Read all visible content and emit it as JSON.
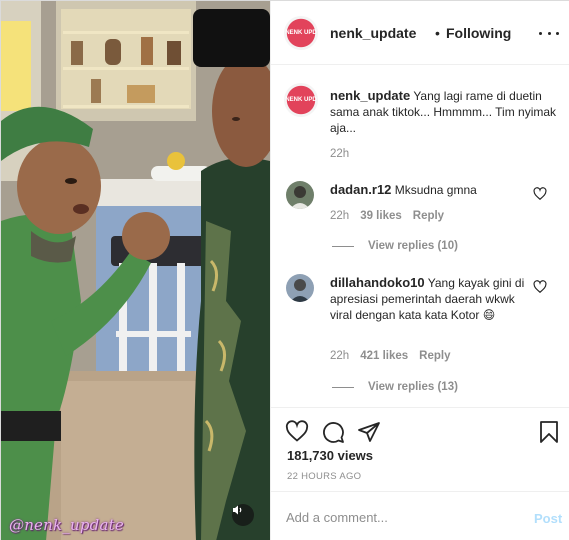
{
  "colors": {
    "accent": "#0095f6",
    "post_disabled": "#b2dffc",
    "muted": "#8e8e8e",
    "text": "#262626"
  },
  "media": {
    "watermark": "@nenk_update",
    "sound_icon": "speaker-icon"
  },
  "header": {
    "avatar_text": "NENK UPD",
    "username": "nenk_update",
    "separator": "•",
    "follow_status": "Following",
    "more_icon": "more-horizontal-icon"
  },
  "caption": {
    "username": "nenk_update",
    "text": "Yang lagi rame di duetin sama anak tiktok... Hmmmm... Tim nyimak aja...",
    "time": "22h"
  },
  "comments": [
    {
      "username": "dadan.r12",
      "text": "Mksudna gmna",
      "time": "22h",
      "likes": "39 likes",
      "reply": "Reply",
      "view_replies": "View replies (10)"
    },
    {
      "username": "dillahandoko10",
      "text": "Yang kayak gini di apresiasi pemerintah daerah wkwk viral dengan kata kata Kotor 😄",
      "time": "22h",
      "likes": "421 likes",
      "reply": "Reply",
      "view_replies": "View replies (13)"
    }
  ],
  "actions": {
    "like_icon": "heart-icon",
    "comment_icon": "comment-icon",
    "share_icon": "send-icon",
    "save_icon": "bookmark-icon"
  },
  "stats": {
    "views": "181,730 views",
    "posted": "22 HOURS AGO"
  },
  "add_comment": {
    "placeholder": "Add a comment...",
    "post_label": "Post"
  }
}
